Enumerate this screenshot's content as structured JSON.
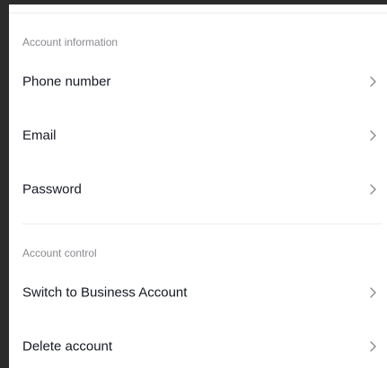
{
  "account_information": {
    "header": "Account information",
    "items": [
      {
        "label": "Phone number",
        "icon": "chevron-right-icon"
      },
      {
        "label": "Email",
        "icon": "chevron-right-icon"
      },
      {
        "label": "Password",
        "icon": "chevron-right-icon"
      }
    ]
  },
  "account_control": {
    "header": "Account control",
    "items": [
      {
        "label": "Switch to Business Account",
        "icon": "chevron-right-icon"
      },
      {
        "label": "Delete account",
        "icon": "chevron-right-icon"
      }
    ]
  },
  "colors": {
    "background": "#ffffff",
    "frame": "#2b2b2b",
    "section_header": "#8a8a8f",
    "row_text": "#161823",
    "chevron": "#8a8a8f",
    "divider": "#ececec"
  }
}
